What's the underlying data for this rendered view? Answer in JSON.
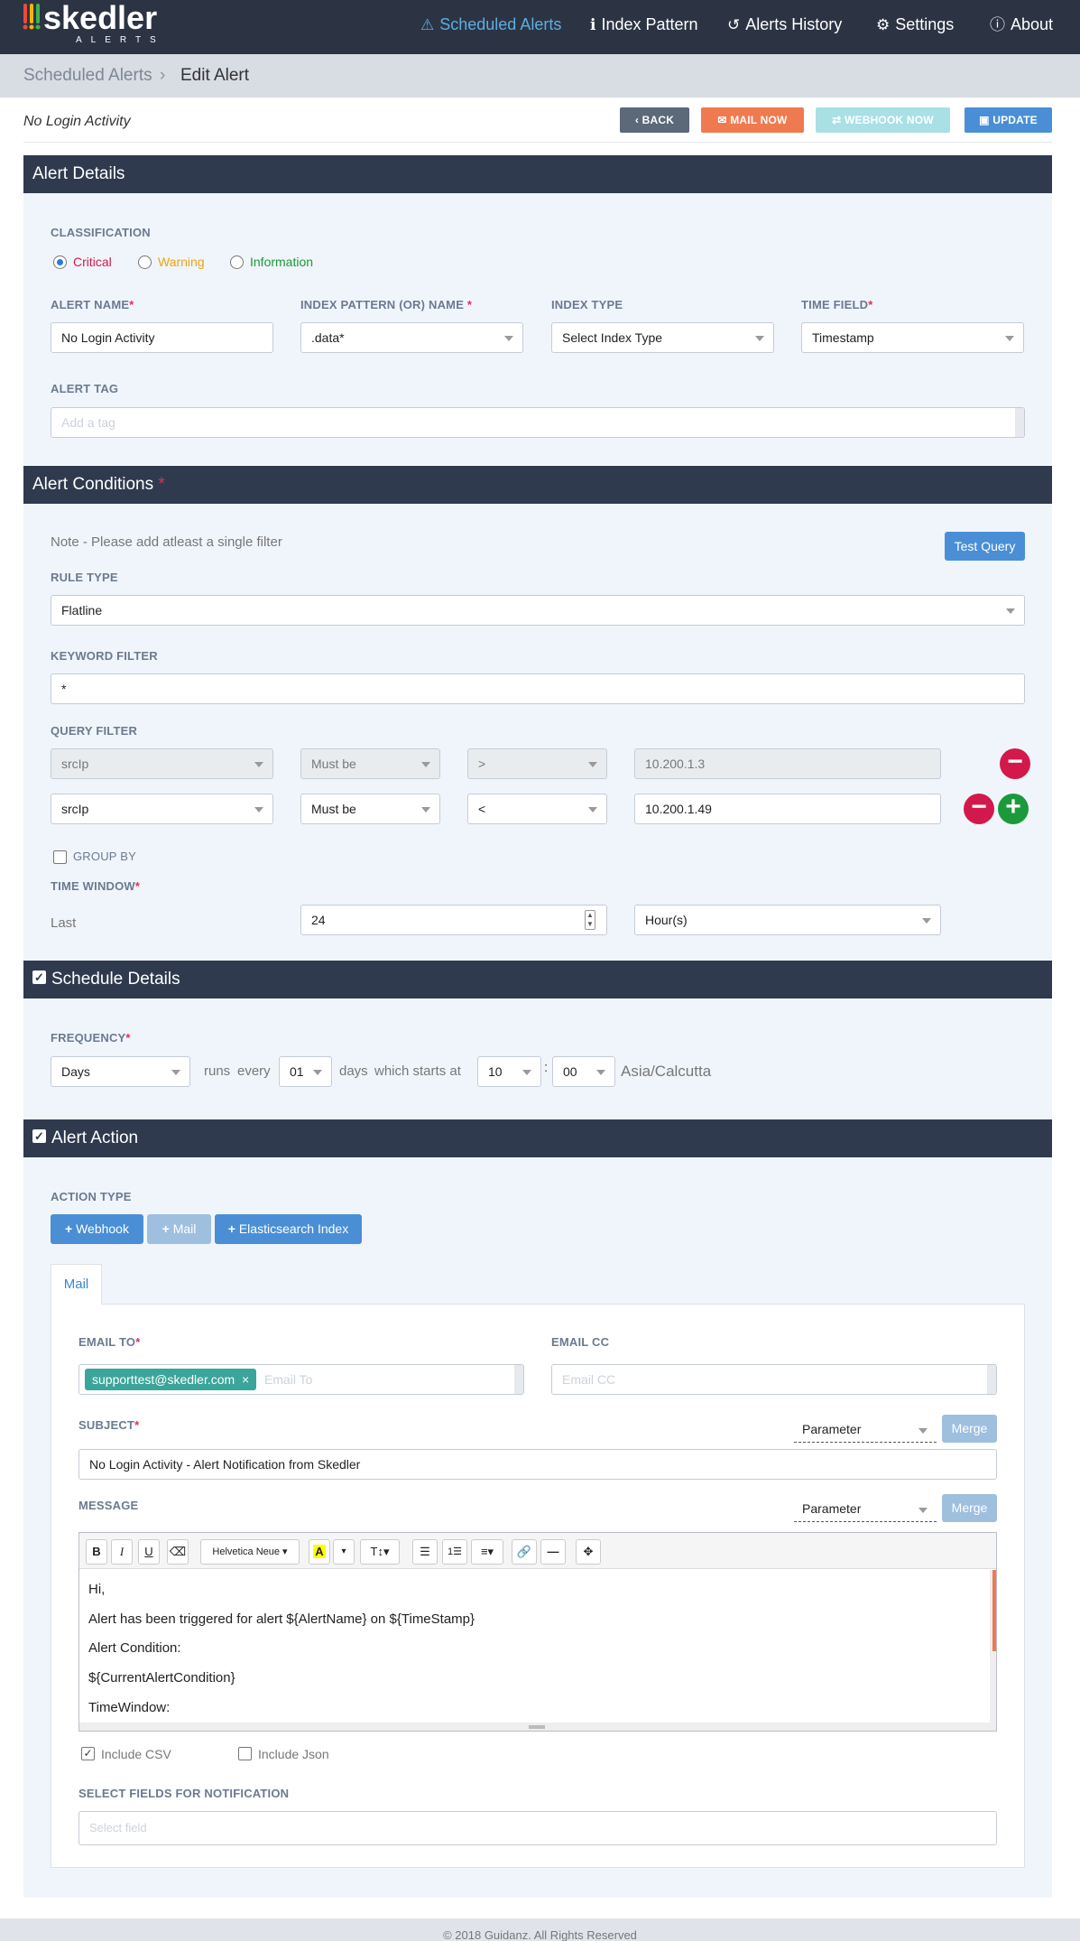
{
  "app": {
    "logo_text": "skedler",
    "logo_sub": "ALERTS"
  },
  "nav": [
    {
      "label": "Scheduled Alerts",
      "icon": "warning-icon",
      "active": true
    },
    {
      "label": "Index Pattern",
      "icon": "info-icon"
    },
    {
      "label": "Alerts History",
      "icon": "history-icon"
    },
    {
      "label": "Settings",
      "icon": "gears-icon"
    },
    {
      "label": "About",
      "icon": "info-circle-icon"
    }
  ],
  "breadcrumb": {
    "parent": "Scheduled Alerts",
    "current": "Edit Alert"
  },
  "alert_title": "No Login Activity",
  "actions": {
    "back": "BACK",
    "mail_now": "MAIL NOW",
    "webhook_now": "WEBHOOK NOW",
    "update": "UPDATE"
  },
  "alert_details": {
    "title": "Alert Details",
    "classification_label": "CLASSIFICATION",
    "classification": [
      {
        "label": "Critical",
        "color": "#d3194b",
        "selected": true
      },
      {
        "label": "Warning",
        "color": "#f0a30a",
        "selected": false
      },
      {
        "label": "Information",
        "color": "#1a9a3a",
        "selected": false
      }
    ],
    "alert_name_label": "ALERT NAME",
    "alert_name": "No Login Activity",
    "index_pattern_label": "INDEX PATTERN (OR) NAME",
    "index_pattern": ".data*",
    "index_type_label": "INDEX TYPE",
    "index_type": "Select Index Type",
    "time_field_label": "TIME FIELD",
    "time_field": "Timestamp",
    "alert_tag_label": "ALERT TAG",
    "alert_tag_placeholder": "Add a tag"
  },
  "alert_conditions": {
    "title": "Alert Conditions",
    "req_mark": "*",
    "note": "Note - Please add atleast a single filter",
    "test_query": "Test Query",
    "rule_type_label": "RULE TYPE",
    "rule_type": "Flatline",
    "keyword_filter_label": "KEYWORD FILTER",
    "keyword_filter": "*",
    "query_filter_label": "QUERY FILTER",
    "filters": [
      {
        "field": "srcIp",
        "condition": "Must be",
        "operator": ">",
        "value": "10.200.1.3",
        "disabled": true
      },
      {
        "field": "srcIp",
        "condition": "Must be",
        "operator": "<",
        "value": "10.200.1.49",
        "disabled": false
      }
    ],
    "group_by_label": "GROUP BY",
    "time_window_label": "TIME WINDOW",
    "last_label": "Last",
    "time_window_value": "24",
    "time_window_unit": "Hour(s)"
  },
  "schedule": {
    "title": "Schedule Details",
    "frequency_label": "FREQUENCY",
    "frequency": "Days",
    "runs": "runs",
    "every": "every",
    "every_value": "01",
    "days": "days",
    "starts_at": "which starts at",
    "hour": "10",
    "colon": ":",
    "minute": "00",
    "timezone": "Asia/Calcutta"
  },
  "alert_action": {
    "title": "Alert Action",
    "action_type_label": "ACTION TYPE",
    "buttons": [
      "Webhook",
      "Mail",
      "Elasticsearch Index"
    ],
    "tab": "Mail",
    "email_to_label": "EMAIL TO",
    "email_tag": "supporttest@skedler.com",
    "email_to_placeholder": "Email To",
    "email_cc_label": "EMAIL CC",
    "email_cc_placeholder": "Email CC",
    "subject_label": "SUBJECT",
    "parameter": "Parameter",
    "merge": "Merge",
    "subject": "No Login Activity - Alert Notification from Skedler",
    "message_label": "MESSAGE",
    "font_name": "Helvetica Neue",
    "message_lines": [
      "Hi,",
      "Alert has been triggered for alert ${AlertName} on ${TimeStamp}",
      "Alert Condition:",
      "${CurrentAlertCondition}",
      "TimeWindow:"
    ],
    "include_csv": "Include CSV",
    "include_json": "Include Json",
    "select_fields_label": "SELECT FIELDS FOR NOTIFICATION",
    "select_field_placeholder": "Select field"
  },
  "footer": "© 2018 Guidanz. All Rights Reserved",
  "colors": {
    "nav_bg": "#2c3444",
    "section_bg": "#2f3a4e",
    "accent": "#4a8fd5",
    "mail_btn": "#f07a4f",
    "danger": "#d3194b",
    "success": "#1a9a3a"
  }
}
